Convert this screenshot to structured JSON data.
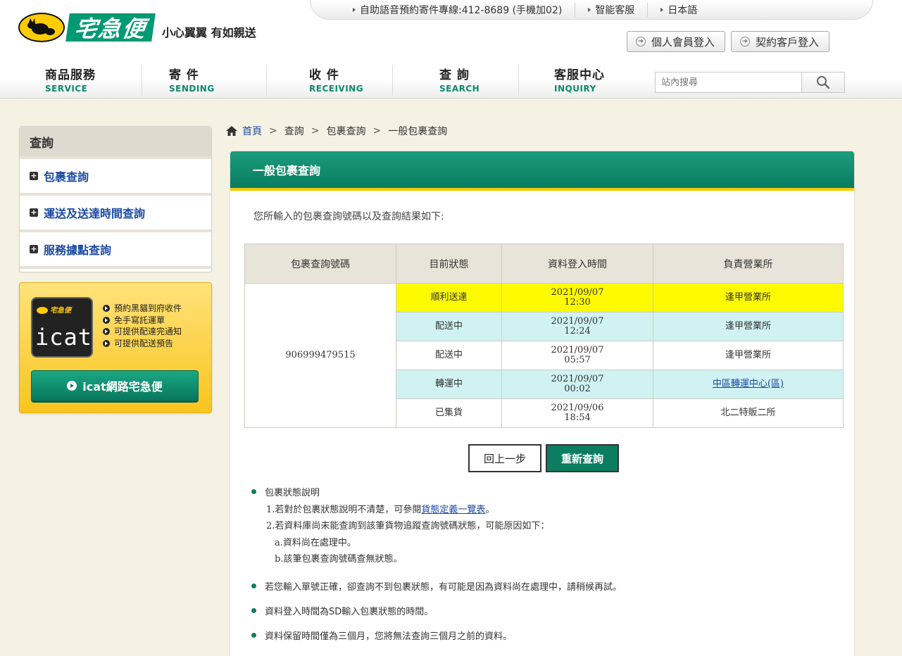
{
  "topbar": {
    "links": [
      "自助語音預約寄件專線:412-8689 (手機加02)",
      "智能客服",
      "日本語"
    ]
  },
  "brand": {
    "logo_text": "宅急便",
    "slogan": "小心翼翼 有如親送"
  },
  "login": {
    "personal": "個人會員登入",
    "contract": "契約客戶登入"
  },
  "nav": {
    "items": [
      {
        "zh": "商品服務",
        "en": "SERVICE"
      },
      {
        "zh": "寄 件",
        "en": "SENDING"
      },
      {
        "zh": "收 件",
        "en": "RECEIVING"
      },
      {
        "zh": "查 詢",
        "en": "SEARCH"
      },
      {
        "zh": "客服中心",
        "en": "INQUIRY"
      }
    ]
  },
  "search": {
    "placeholder": "站內搜尋"
  },
  "sidebar": {
    "title": "查詢",
    "items": [
      "包裹查詢",
      "運送及送達時間查詢",
      "服務據點查詢"
    ]
  },
  "icat": {
    "mini_logo": "宅急便",
    "logo_word": "icat",
    "features": [
      "預約黑貓到府收件",
      "免手寫託運單",
      "可提供配達完通知",
      "可提供配送預告"
    ],
    "button": "icat網路宅急便"
  },
  "breadcrumb": {
    "home": "首頁",
    "items": [
      "查詢",
      "包裹查詢",
      "一般包裹查詢"
    ]
  },
  "panel": {
    "title": "一般包裹查詢",
    "intro": "您所輸入的包裹查詢號碼以及查詢結果如下:"
  },
  "table": {
    "headers": [
      "包裹查詢號碼",
      "目前狀態",
      "資料登入時間",
      "負責營業所"
    ],
    "tracking_number": "906999479515",
    "rows": [
      {
        "status": "順利送達",
        "date": "2021/09/07",
        "time": "12:30",
        "office": "逢甲營業所"
      },
      {
        "status": "配送中",
        "date": "2021/09/07",
        "time": "12:24",
        "office": "逢甲營業所"
      },
      {
        "status": "配送中",
        "date": "2021/09/07",
        "time": "05:57",
        "office": "逢甲營業所"
      },
      {
        "status": "轉運中",
        "date": "2021/09/07",
        "time": "00:02",
        "office": "中區轉運中心(區)"
      },
      {
        "status": "已集貨",
        "date": "2021/09/06",
        "time": "18:54",
        "office": "北二特販二所"
      }
    ]
  },
  "buttons": {
    "back": "回上一步",
    "requery": "重新查詢"
  },
  "notes": {
    "n1_title": "包裹狀態說明",
    "n1_line1_pre": "1.若對於包裹狀態說明不清楚，可參閱",
    "n1_line1_link": "貨態定義一覽表",
    "n1_line1_post": "。",
    "n1_line2": "2.若資料庫尚未能查詢到該筆貨物追蹤查詢號碼狀態，可能原因如下：",
    "n1_line3": "a.資料尚在處理中。",
    "n1_line4": "b.該筆包裹查詢號碼查無狀態。",
    "n2": "若您輸入單號正確，卻查詢不到包裹狀態，有可能是因為資料尚在處理中，請稍候再試。",
    "n3": "資料登入時間為SD輸入包裹狀態的時間。",
    "n4": "資料保留時間僅為三個月，您將無法查詢三個月之前的資料。"
  },
  "colors": {
    "brand_green": "#0b7e62",
    "highlight_yellow": "#fefa00",
    "row_cyan": "#d0f2f2",
    "link_blue": "#1a4aa3"
  }
}
